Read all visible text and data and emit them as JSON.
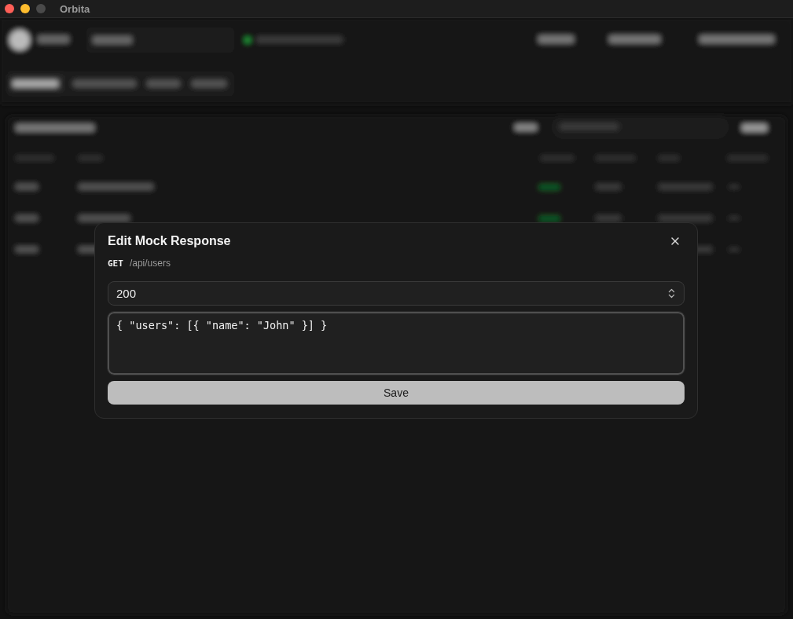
{
  "window": {
    "title": "Orbita"
  },
  "dialog": {
    "title": "Edit Mock Response",
    "method": "GET",
    "path": "/api/users",
    "status": {
      "value": "200"
    },
    "body": {
      "value": "{ \"users\": [{ \"name\": \"John\" }] }"
    },
    "buttons": [
      {
        "label": "Save"
      }
    ]
  }
}
